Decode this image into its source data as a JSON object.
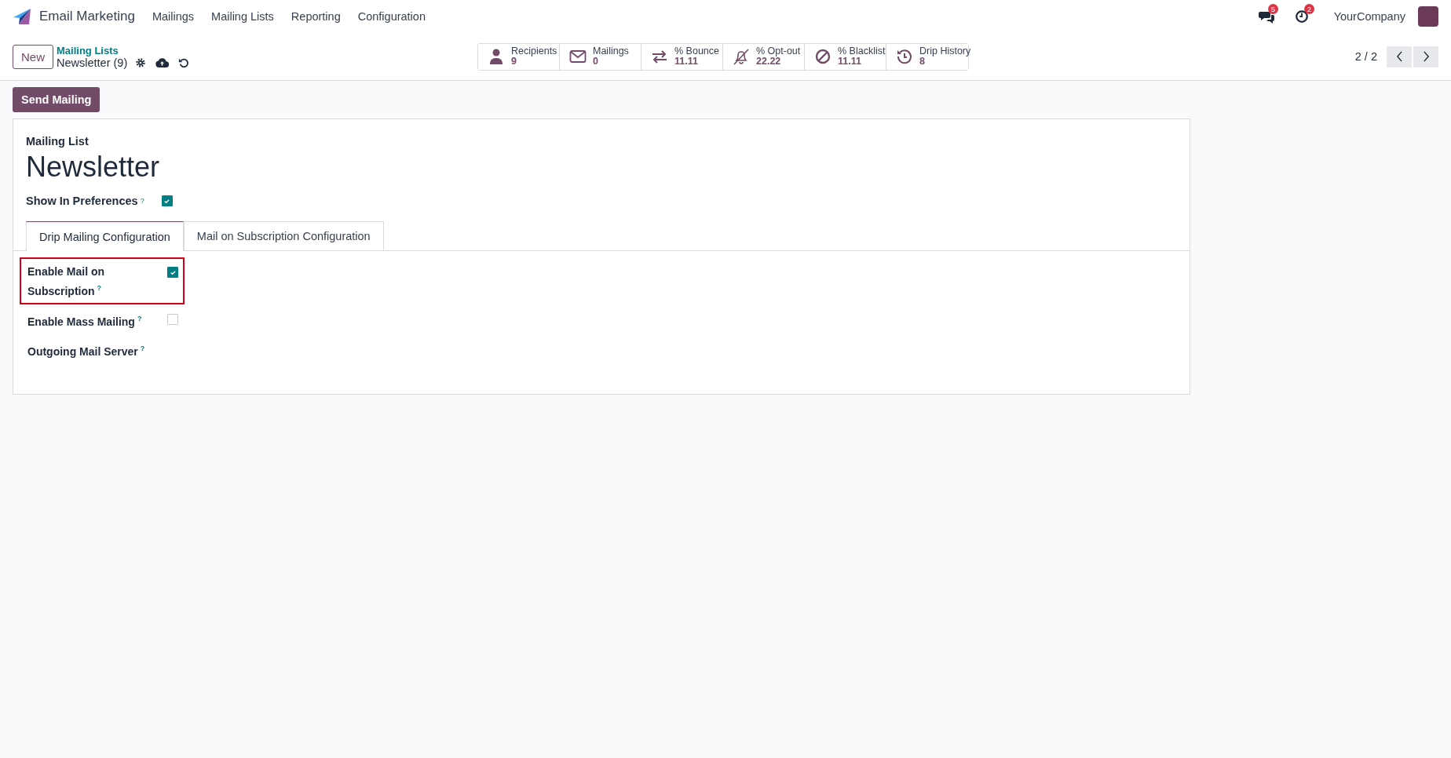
{
  "navbar": {
    "app_name": "Email Marketing",
    "menu": [
      "Mailings",
      "Mailing Lists",
      "Reporting",
      "Configuration"
    ],
    "chat_badge": "5",
    "activity_badge": "2",
    "company": "YourCompany"
  },
  "control_panel": {
    "new_button": "New",
    "breadcrumb": "Mailing Lists",
    "record": "Newsletter (9)",
    "pager": "2 / 2",
    "stats": [
      {
        "kind": "person",
        "label": "Recipients",
        "value": "9"
      },
      {
        "kind": "envelope",
        "label": "Mailings",
        "value": "0"
      },
      {
        "kind": "arrows",
        "label": "% Bounce",
        "value": "11.11"
      },
      {
        "kind": "bell-off",
        "label": "% Opt-out",
        "value": "22.22"
      },
      {
        "kind": "ban",
        "label": "% Blacklist",
        "value": "11.11"
      },
      {
        "kind": "history",
        "label": "Drip History",
        "value": "8"
      }
    ]
  },
  "action_button": "Send Mailing",
  "form": {
    "caption": "Mailing List",
    "title": "Newsletter",
    "show_in_preferences": {
      "label": "Show In Preferences",
      "help": "?",
      "checked": true
    },
    "tabs": [
      {
        "label": "Drip Mailing Configuration",
        "selected": true
      },
      {
        "label": "Mail on Subscription Configuration",
        "selected": false
      }
    ],
    "fields": [
      {
        "kind": "checkbox",
        "label": "Enable Mail on Subscription",
        "help": "?",
        "checked": true,
        "highlighted": true
      },
      {
        "kind": "checkbox",
        "label": "Enable Mass Mailing",
        "help": "?",
        "checked": false,
        "highlighted": false
      },
      {
        "kind": "empty",
        "label": "Outgoing Mail Server",
        "help": "?"
      }
    ]
  }
}
